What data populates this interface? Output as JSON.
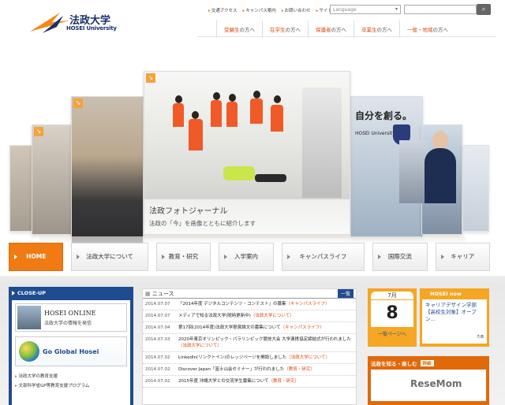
{
  "brand": {
    "name": "法政大学",
    "name_en": "HOSEI University"
  },
  "utility_links": [
    "交通アクセス",
    "キャンパス案内",
    "お問い合わせ",
    "サイトマップ"
  ],
  "language": {
    "label": "Language"
  },
  "audience_links": [
    {
      "prefix": "受験生",
      "suffix": "の方へ"
    },
    {
      "prefix": "在学生",
      "suffix": "の方へ"
    },
    {
      "prefix": "保護者",
      "suffix": "の方へ"
    },
    {
      "prefix": "卒業生",
      "suffix": "の方へ"
    },
    {
      "prefix": "一般・地域",
      "suffix": "の方へ"
    }
  ],
  "hero": {
    "caption_title": "法政フォトジャーナル",
    "caption_sub": "法政の「今」を画像とともに紹介します",
    "slogan": "自分を創る。",
    "slogan_sub": "HOSEI University"
  },
  "nav": [
    "HOME",
    "法政大学について",
    "教育・研究",
    "入学案内",
    "キャンパスライフ",
    "国際交流",
    "キャリア"
  ],
  "closeup": {
    "title": "CLOSE-UP",
    "banner1_title": "HOSEI ONLINE",
    "banner1_sub": "法政大学の情報を発信",
    "banner2_title": "Go Global Hosei",
    "links": [
      "法政大学の教育支援",
      "文部科学省GP等教育支援プログラム"
    ]
  },
  "news": {
    "title": "ニュース",
    "list_button": "一覧",
    "items": [
      {
        "date": "2014.07.07",
        "title": "「2014年度 デジタルコンテンツ・コンテスト」の募集",
        "category": "（キャンパスライフ）"
      },
      {
        "date": "2014.07.07",
        "title": "メディアで知る法政大学(随時更新中)",
        "category": "（法政大学について）"
      },
      {
        "date": "2014.07.04",
        "title": "第17回(2014年度)法政大学懸賞論文の募集について",
        "category": "（キャンパスライフ）"
      },
      {
        "date": "2014.07.03",
        "title": "2020年東京オリンピック・パラリンピック競技大会 大学連携協定締結式が行われました",
        "category": "（法政大学について）"
      },
      {
        "date": "2014.07.02",
        "title": "LinkedIn(リンクトイン)のレッジページを開設しました",
        "category": "（法政大学について）"
      },
      {
        "date": "2014.07.02",
        "title": "Discover Japan「富士山会セミナー」が行われました",
        "category": "（教育・研究）"
      },
      {
        "date": "2014.07.02",
        "title": "2015年度 沖縄大学との交流学生募集について",
        "category": "（教育・研究）"
      }
    ]
  },
  "calendar": {
    "month": "7月",
    "day": "8",
    "all_link": "一覧ページへ"
  },
  "hosei_now": {
    "title": "HOSEI now",
    "text": "キャリアデザイン学部【高校生対象】オープン...",
    "page": "7/8"
  },
  "enjoy": {
    "title": "法政を知る・楽しむ",
    "detail": "詳細"
  },
  "watermark": "ReseMom"
}
